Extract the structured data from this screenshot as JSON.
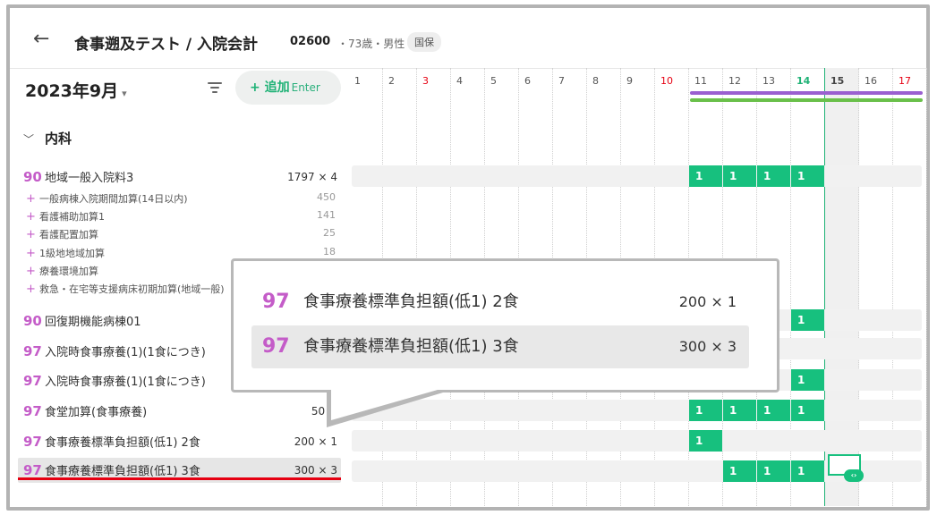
{
  "header": {
    "back_icon": "←",
    "title": "食事遡及テスト / 入院会計",
    "patient_id": "02600",
    "patient_info": "・73歳・男性",
    "insurance": "国保"
  },
  "toolbar": {
    "month": "2023年9月",
    "add_label": "+ 追加",
    "add_shortcut": "Enter"
  },
  "section": {
    "title": "内科"
  },
  "calendar": {
    "days": [
      "1",
      "2",
      "3",
      "4",
      "5",
      "6",
      "7",
      "8",
      "9",
      "10",
      "11",
      "12",
      "13",
      "14",
      "15",
      "16",
      "17"
    ],
    "red_days": [
      "3",
      "10",
      "17"
    ],
    "today": "14",
    "selected_day": "15"
  },
  "rows": [
    {
      "code": "90",
      "name": "地域一般入院料3",
      "qty": "1797 × 4"
    },
    {
      "code": "90",
      "name": "回復期機能病棟01",
      "qty": ""
    },
    {
      "code": "97",
      "name": "入院時食事療養(1)(1食につき)",
      "qty": ""
    },
    {
      "code": "97",
      "name": "入院時食事療養(1)(1食につき)",
      "qty": ""
    },
    {
      "code": "97",
      "name": "食堂加算(食事療養)",
      "qty": "50 ×"
    },
    {
      "code": "97",
      "name": "食事療養標準負担額(低1) 2食",
      "qty": "200 × 1"
    },
    {
      "code": "97",
      "name": "食事療養標準負担額(低1) 3食",
      "qty": "300 × 3"
    }
  ],
  "subrows": [
    {
      "name": "一般病棟入院期間加算(14日以内)",
      "value": "450"
    },
    {
      "name": "看護補助加算1",
      "value": "141"
    },
    {
      "name": "看護配置加算",
      "value": "25"
    },
    {
      "name": "1級地地域加算",
      "value": "18"
    },
    {
      "name": "療養環境加算",
      "value": ""
    },
    {
      "name": "救急・在宅等支援病床初期加算(地域一般)",
      "value": ""
    }
  ],
  "grid_cell_value": "1",
  "popup": {
    "items": [
      {
        "code": "97",
        "name": "食事療養標準負担額(低1) 2食",
        "qty": "200 × 1"
      },
      {
        "code": "97",
        "name": "食事療養標準負担額(低1) 3食",
        "qty": "300 × 3"
      }
    ]
  },
  "colors": {
    "accent": "#17c07e",
    "code": "#c45cc8",
    "holiday": "#e60012",
    "purple_bar": "#9a5fd0",
    "green_bar": "#6ac04a"
  }
}
